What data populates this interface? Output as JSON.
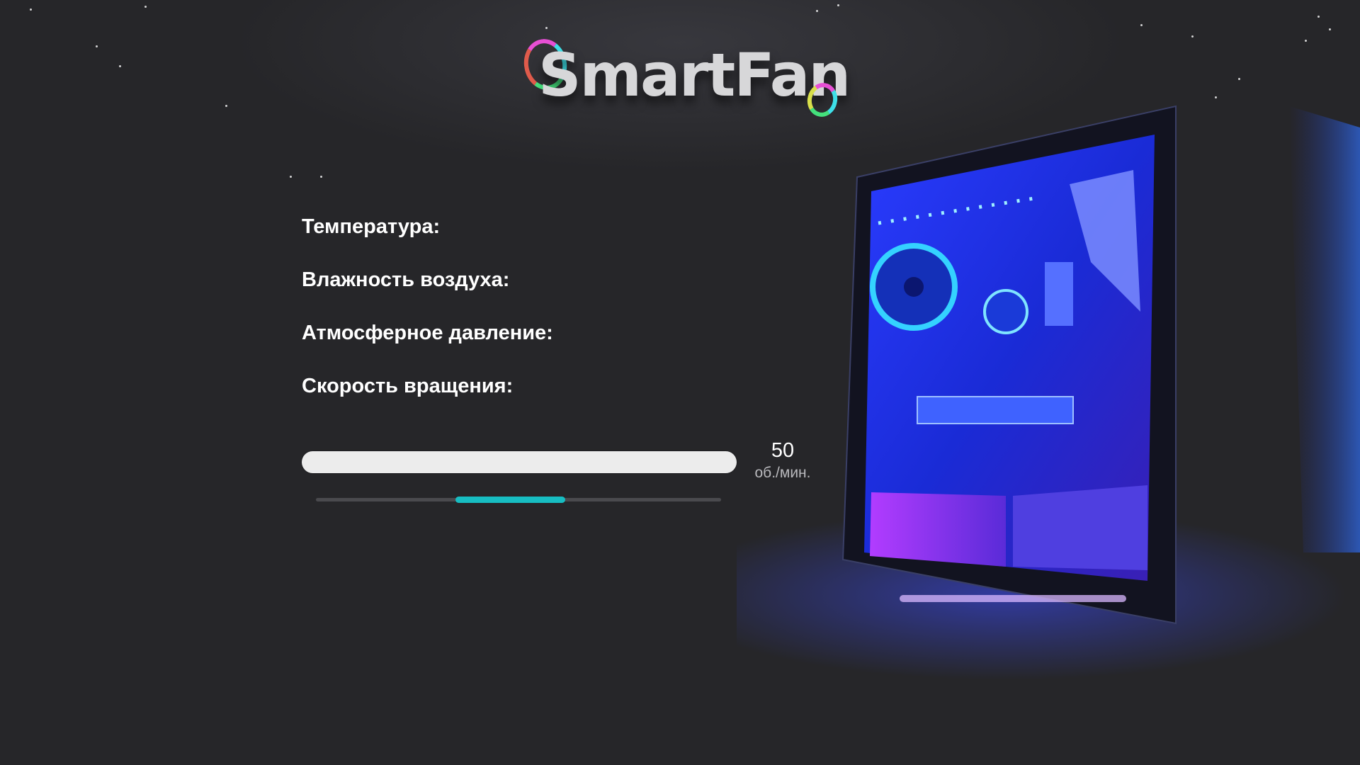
{
  "app": {
    "logo_text": "SmartFan"
  },
  "info": {
    "temperature_label": "Температура:",
    "humidity_label": "Влажность воздуха:",
    "pressure_label": "Атмосферное давление:",
    "speed_label": "Скорость вращения:"
  },
  "speed": {
    "value": "50",
    "unit": "об./мин.",
    "slider_start_fraction": 0.345,
    "slider_end_fraction": 0.615
  },
  "colors": {
    "background": "#262629",
    "accent": "#17bdc2",
    "pc_glow": "#3b4bff",
    "pc_underglow": "#c9a0ff"
  },
  "icons": {
    "logo_fans": "rgb-fan-icon",
    "case_art": "pc-case-image"
  }
}
